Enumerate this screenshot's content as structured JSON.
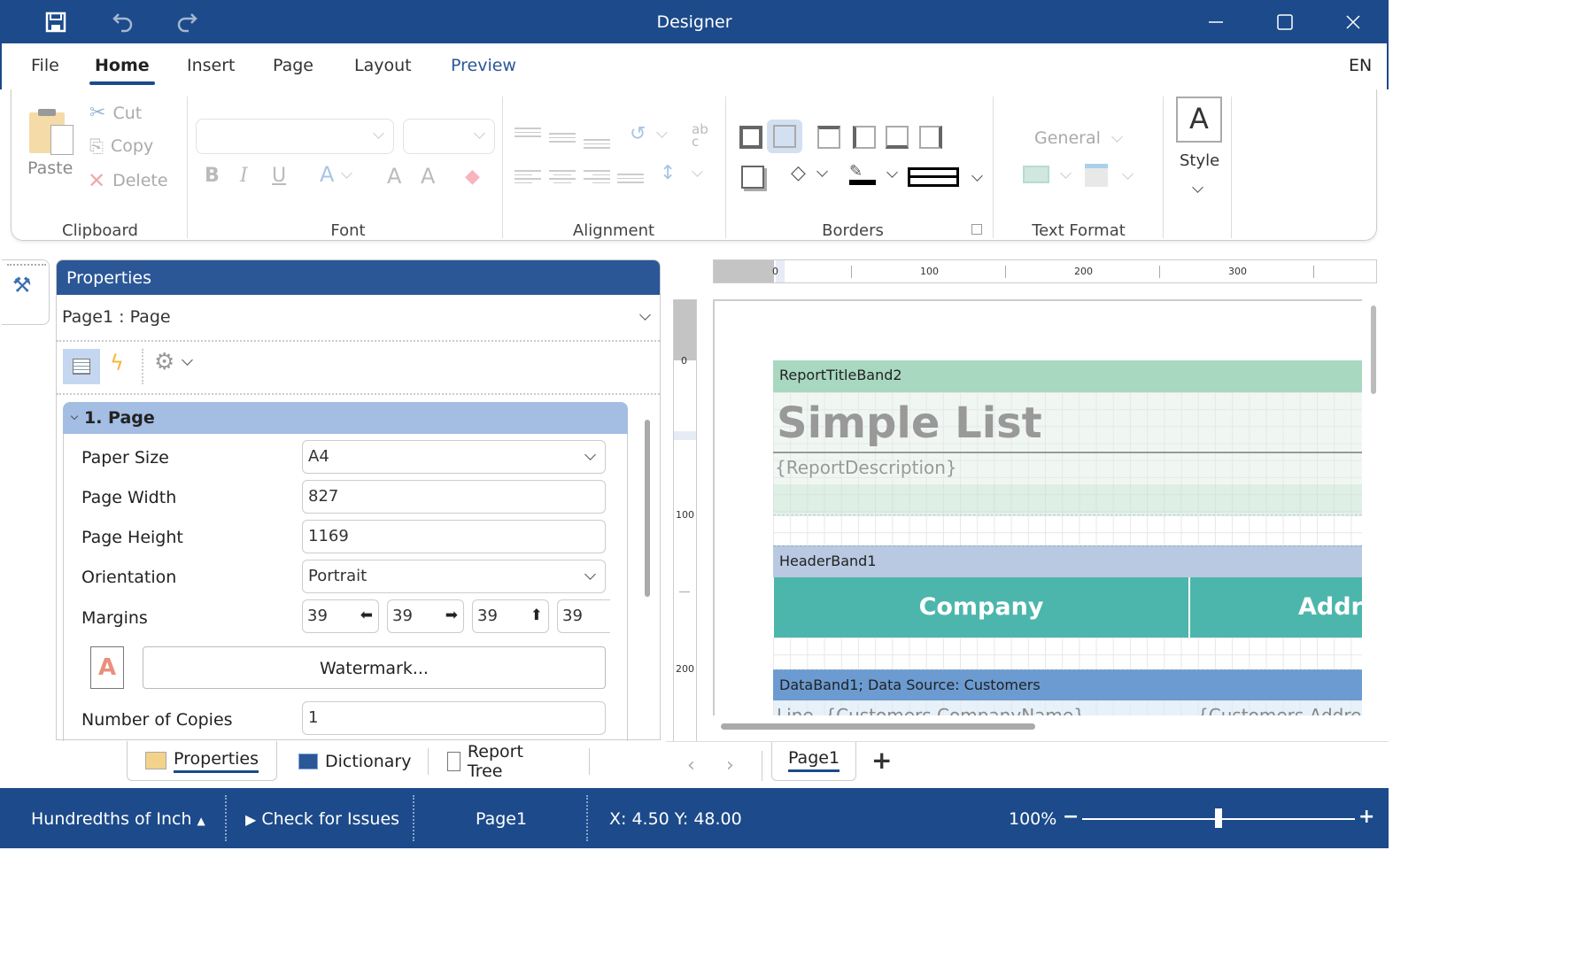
{
  "window": {
    "title": "Designer",
    "quick_access": [
      {
        "name": "save",
        "icon": "save-icon"
      },
      {
        "name": "undo",
        "icon": "undo-icon"
      },
      {
        "name": "redo",
        "icon": "redo-icon"
      }
    ],
    "controls": [
      "minimize",
      "maximize",
      "close"
    ]
  },
  "menu": {
    "items": [
      "File",
      "Home",
      "Insert",
      "Page",
      "Layout",
      "Preview"
    ],
    "active": "Home",
    "language": "EN"
  },
  "ribbon": {
    "clipboard": {
      "label": "Clipboard",
      "paste": "Paste",
      "cut": "Cut",
      "copy": "Copy",
      "delete": "Delete"
    },
    "font": {
      "label": "Font",
      "bold": "B",
      "italic": "I",
      "underline": "U",
      "color": "A",
      "grow": "A",
      "shrink": "A"
    },
    "alignment": {
      "label": "Alignment",
      "wrap": "ab c"
    },
    "borders": {
      "label": "Borders"
    },
    "text_format": {
      "label": "Text Format",
      "format_value": "General"
    },
    "style": {
      "label": "Style",
      "icon_text": "A"
    }
  },
  "properties": {
    "title": "Properties",
    "selected_object": "Page1 : Page",
    "category": "1. Page",
    "rows": [
      {
        "label": "Paper Size",
        "value": "A4",
        "type": "select"
      },
      {
        "label": "Page Width",
        "value": "827",
        "type": "text"
      },
      {
        "label": "Page Height",
        "value": "1169",
        "type": "text"
      },
      {
        "label": "Orientation",
        "value": "Portrait",
        "type": "select"
      }
    ],
    "margins": {
      "label": "Margins",
      "left": "39",
      "right": "39",
      "top": "39",
      "bottom": "39"
    },
    "watermark_button": "Watermark...",
    "copies": {
      "label": "Number of Copies",
      "value": "1"
    }
  },
  "panel_tabs": [
    {
      "label": "Properties",
      "active": true
    },
    {
      "label": "Dictionary",
      "active": false
    },
    {
      "label": "Report Tree",
      "active": false
    }
  ],
  "canvas": {
    "ruler_h": [
      "0",
      "100",
      "200",
      "300"
    ],
    "ruler_v": [
      "0",
      "100",
      "200"
    ],
    "bands": {
      "title_band": "ReportTitleBand2",
      "title_text": "Simple List",
      "description": "{ReportDescription}",
      "header_band": "HeaderBand1",
      "header_cols": [
        "Company",
        "Addre"
      ],
      "data_band": "DataBand1; Data Source: Customers",
      "data_row_left": "Line, {Customers.CompanyName}",
      "data_row_right": "{Customers.Address}"
    },
    "colors": {
      "title_band": "#a8d8c0",
      "header_band": "#b8c9e1",
      "header_cell": "#4db6ac",
      "data_band": "#6b9bd1"
    }
  },
  "page_tabs": {
    "items": [
      "Page1"
    ],
    "add": "+"
  },
  "status": {
    "units": "Hundredths of Inch",
    "check": "Check for Issues",
    "page": "Page1",
    "coords": "X: 4.50 Y: 48.00",
    "zoom": "100%",
    "zoom_minus": "−",
    "zoom_plus": "+",
    "zoom_level": 0.5
  }
}
